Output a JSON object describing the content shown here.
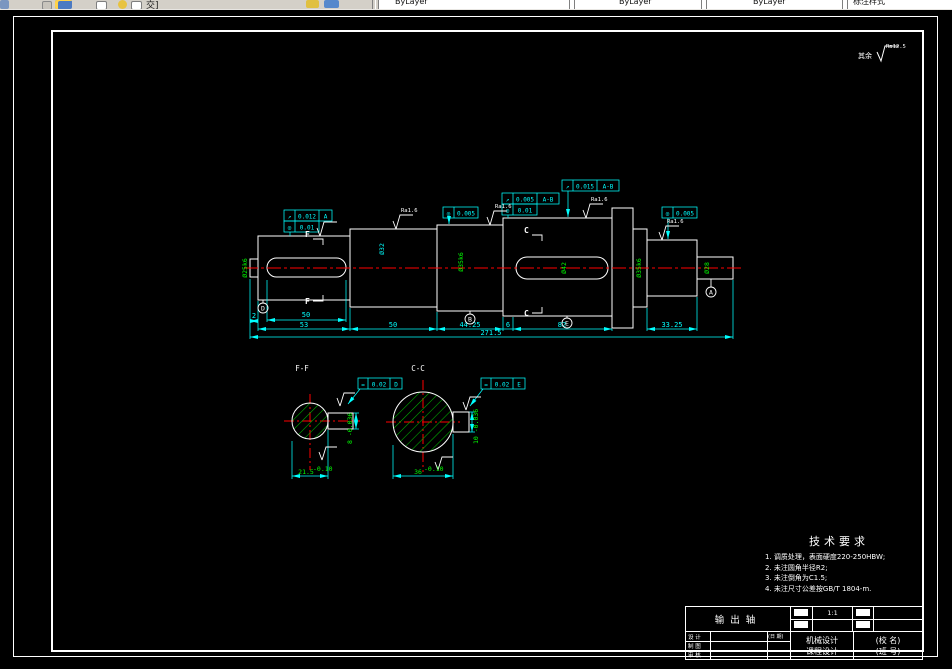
{
  "toolbar": {
    "combo_bylayer_1": "ByLayer",
    "combo_bylayer_2": "ByLayer",
    "combo_bylayer_3": "ByLayer",
    "style_label": "标注样式",
    "fragment": "交]"
  },
  "corner": {
    "rest_label": "其余",
    "rest_ra": "Ra12.5"
  },
  "ra": {
    "value": "Ra1.6"
  },
  "cuts": {
    "f": "F",
    "c": "C"
  },
  "datums": {
    "a": "A",
    "b": "B",
    "d": "D",
    "e": "E"
  },
  "gdt": {
    "f1": {
      "sym": "↗",
      "val": "0.012",
      "ref": "A"
    },
    "f2": {
      "sym": "◎",
      "val": "0.01"
    },
    "f3": {
      "sym": "◎",
      "val": "0.005"
    },
    "f4": {
      "sym": "↗",
      "val": "0.005",
      "ref": "A-B"
    },
    "f5": {
      "sym": "◎",
      "val": "0.01"
    },
    "f6": {
      "sym": "↗",
      "val": "0.015",
      "ref": "A-B"
    },
    "f7": {
      "sym": "◎",
      "val": "0.005"
    },
    "f8": {
      "sym": "=",
      "val": "0.02",
      "ref": "D"
    },
    "f9": {
      "sym": "=",
      "val": "0.02",
      "ref": "E"
    }
  },
  "dims": {
    "overall": "271.5",
    "stub": "2",
    "key1_len": "50",
    "seg1": "53",
    "seg2": "50",
    "seg3": "44.25",
    "gap": "6",
    "seg4": "82",
    "seg7": "33.25"
  },
  "dias": {
    "left": "Ø25k6",
    "seg2": "Ø32",
    "seg3": "Ø35k6",
    "seg4": "Ø42",
    "seg6": "Ø35k6",
    "right": "Ø28"
  },
  "sections": {
    "ff": {
      "title": "F-F",
      "width": "21.5",
      "width_tol": "-0.10",
      "key": "8 -0.036"
    },
    "cc": {
      "title": "C-C",
      "width": "36",
      "width_tol": "-0.10",
      "key": "10 -0.036"
    }
  },
  "tech": {
    "title": "技术要求",
    "l1": "1. 调质处理，表面硬度220-250HBW;",
    "l2": "2. 未注圆角半径R2;",
    "l3": "3. 未注倒角为C1.5;",
    "l4": "4. 未注尺寸公差按GB/T 1804-m."
  },
  "titleblock": {
    "part": "输出轴",
    "scale": "1:1",
    "course_l1": "机械设计",
    "course_l2": "课程设计",
    "school": "(校 名)",
    "classno": "(班 号)",
    "r1": "设 计",
    "r2": "制 图",
    "r3": "审 核",
    "date": "(日 期)"
  }
}
